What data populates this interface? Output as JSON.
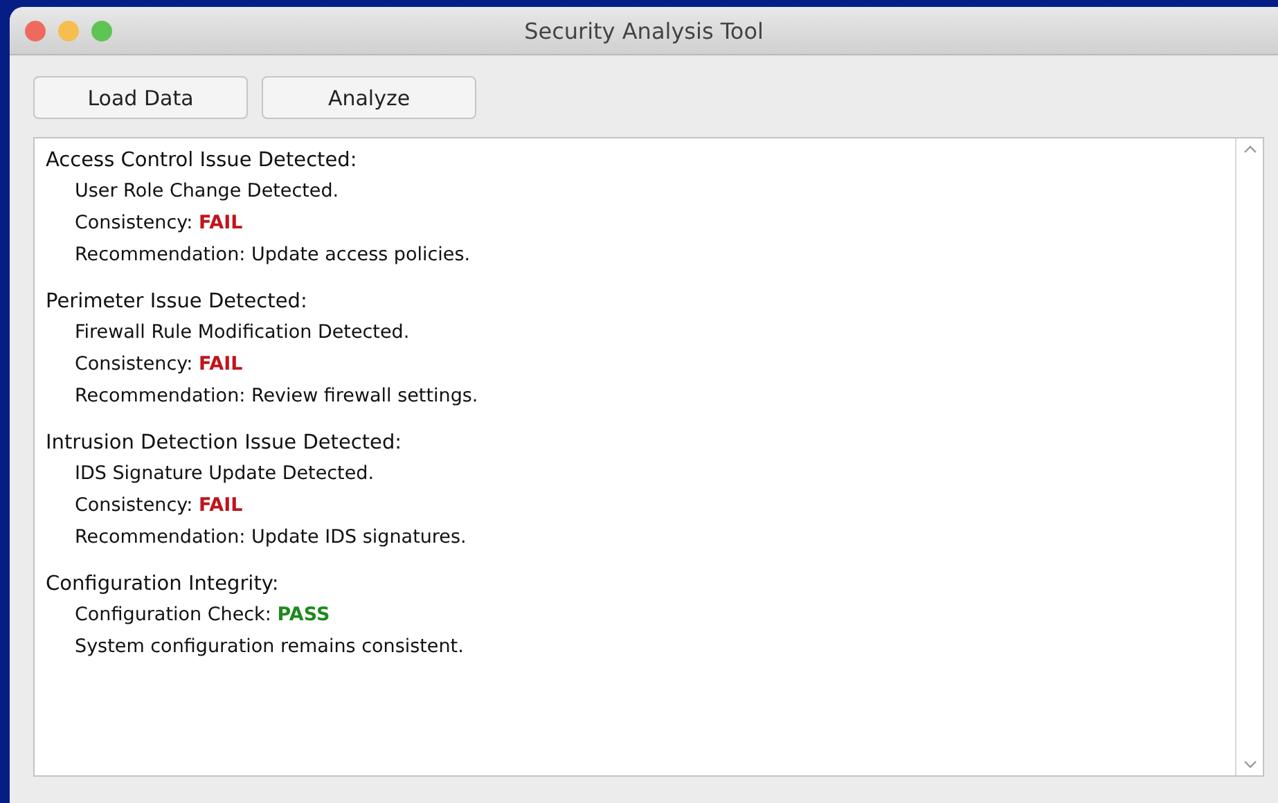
{
  "window": {
    "title": "Security Analysis Tool"
  },
  "buttons": [
    "Load Data",
    "Analyze"
  ],
  "sections": [
    {
      "heading": "Access Control Issue Detected:",
      "lines": [
        {
          "text": "User Role Change Detected."
        },
        {
          "text": "Consistency: ",
          "status": {
            "text": "FAIL",
            "passed": false
          }
        },
        {
          "text": "Recommendation: Update access policies."
        }
      ]
    },
    {
      "heading": "Perimeter Issue Detected:",
      "lines": [
        {
          "text": "Firewall Rule Modification Detected."
        },
        {
          "text": "Consistency: ",
          "status": {
            "text": "FAIL",
            "passed": false
          }
        },
        {
          "text": "Recommendation: Review firewall settings."
        }
      ]
    },
    {
      "heading": "Intrusion Detection Issue Detected:",
      "lines": [
        {
          "text": "IDS Signature Update Detected."
        },
        {
          "text": "Consistency: ",
          "status": {
            "text": "FAIL",
            "passed": false
          }
        },
        {
          "text": "Recommendation: Update IDS signatures."
        }
      ]
    },
    {
      "heading": "Configuration Integrity:",
      "lines": [
        {
          "text": "Configuration Check: ",
          "status": {
            "text": "PASS",
            "passed": true
          }
        },
        {
          "text": "System configuration remains consistent."
        }
      ]
    }
  ]
}
